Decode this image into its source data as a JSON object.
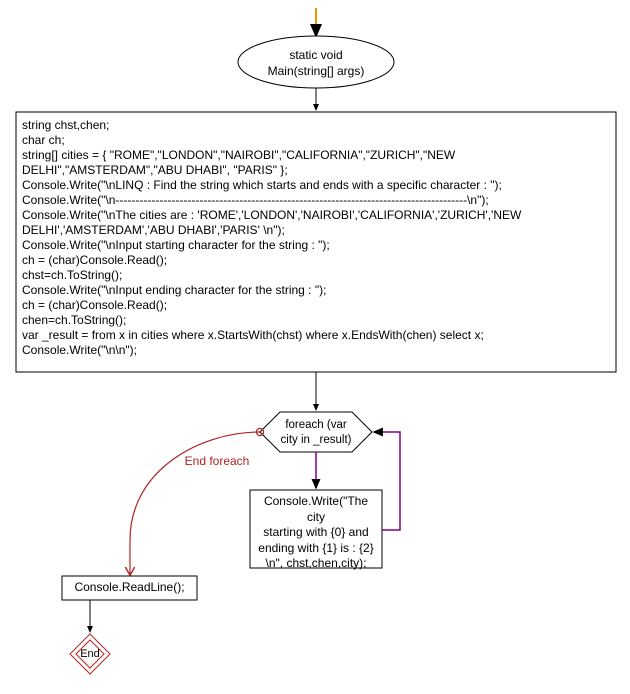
{
  "nodes": {
    "start": {
      "label": "static void\nMain(string[] args)"
    },
    "process": {
      "code": "string chst,chen;\nchar ch;\nstring[] cities = { \"ROME\",\"LONDON\",\"NAIROBI\",\"CALIFORNIA\",\"ZURICH\",\"NEW DELHI\",\"AMSTERDAM\",\"ABU DHABI\", \"PARIS\" };\nConsole.Write(\"\\nLINQ : Find the string which starts and ends with a specific character : \");\nConsole.Write(\"\\n----------------------------------------------------------------------------------------\\n\");\nConsole.Write(\"\\nThe cities are : 'ROME','LONDON','NAIROBI','CALIFORNIA','ZURICH','NEW DELHI','AMSTERDAM','ABU DHABI','PARIS' \\n\");\nConsole.Write(\"\\nInput starting character for the string : \");\nch = (char)Console.Read();\nchst=ch.ToString();\nConsole.Write(\"\\nInput ending character for the string : \");\nch = (char)Console.Read();\nchen=ch.ToString();\nvar _result = from x in cities where x.StartsWith(chst) where x.EndsWith(chen) select x;\nConsole.Write(\"\\n\\n\");"
    },
    "loop": {
      "label": "foreach (var\ncity in _result)"
    },
    "loop_edge": {
      "label": "End foreach"
    },
    "body": {
      "label": "Console.Write(\"The city\nstarting with {0} and\nending with {1} is : {2}\n\\n\", chst,chen,city);"
    },
    "readline": {
      "label": "Console.ReadLine();"
    },
    "end": {
      "label": "End"
    }
  }
}
